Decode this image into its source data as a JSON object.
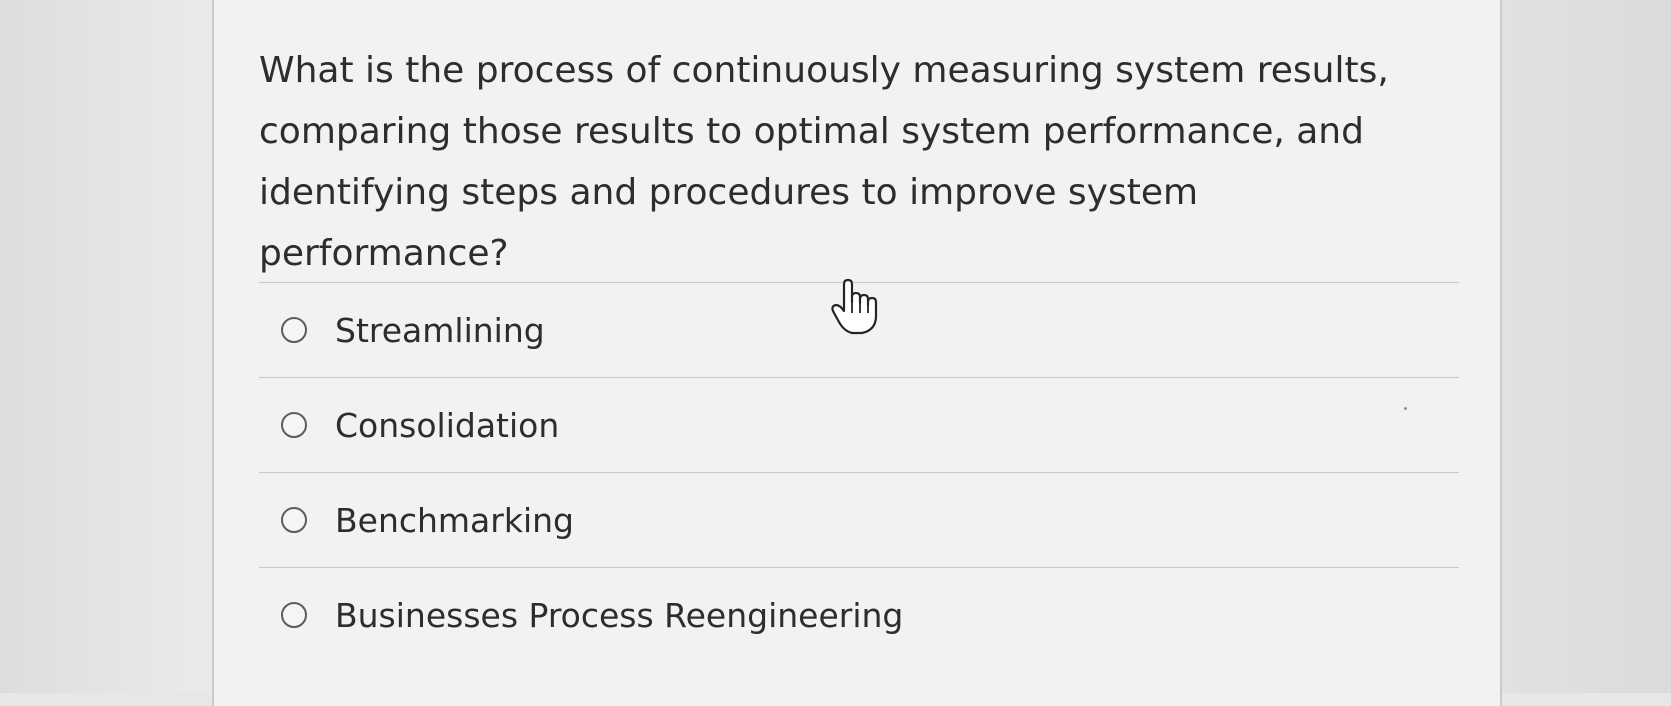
{
  "question": {
    "text": "What is the process of continuously measuring system results, comparing those results to optimal system performance, and identifying steps and procedures to improve system performance?"
  },
  "answers": [
    {
      "label": "Streamlining",
      "selected": false
    },
    {
      "label": "Consolidation",
      "selected": false
    },
    {
      "label": "Benchmarking",
      "selected": false
    },
    {
      "label": "Businesses Process Reengineering",
      "selected": false
    }
  ],
  "icons": {
    "cursor": "hand-pointer-icon",
    "option": "radio-button-icon"
  },
  "colors": {
    "text": "#2b2d2e",
    "divider": "#c8cac9",
    "card_background": "#f1f2f1"
  }
}
